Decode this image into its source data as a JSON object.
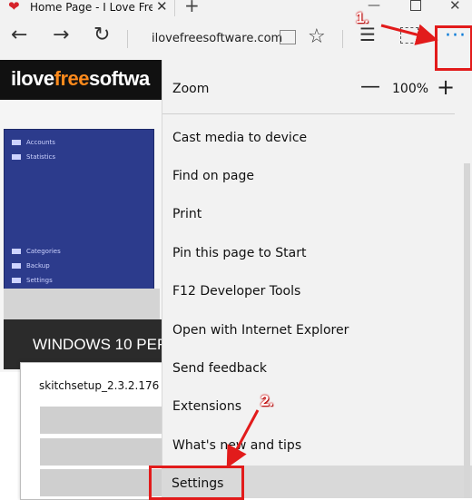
{
  "browser": {
    "tab_title": "Home Page - I Love Free Software",
    "url": "ilovefreesoftware.com"
  },
  "page": {
    "logo_prefix": "ilove",
    "logo_mid": "free",
    "logo_suffix": "softwa",
    "sidebar_items": [
      "Accounts",
      "Statistics",
      "Categories",
      "Backup",
      "Settings"
    ],
    "banner_text": "WINDOWS 10 PER",
    "download_filename": "skitchsetup_2.3.2.176"
  },
  "menu": {
    "zoom_label": "Zoom",
    "zoom_value": "100%",
    "items": [
      "Cast media to device",
      "Find on page",
      "Print",
      "Pin this page to Start",
      "F12 Developer Tools",
      "Open with Internet Explorer",
      "Send feedback",
      "Extensions",
      "What's new and tips",
      "Settings"
    ]
  },
  "annotations": {
    "step1": "1.",
    "step2": "2."
  },
  "colors": {
    "accent_red": "#e21b1b",
    "menu_bg": "#f2f2f2",
    "highlight": "#d9d9d9",
    "edge_blue": "#0078d7"
  }
}
